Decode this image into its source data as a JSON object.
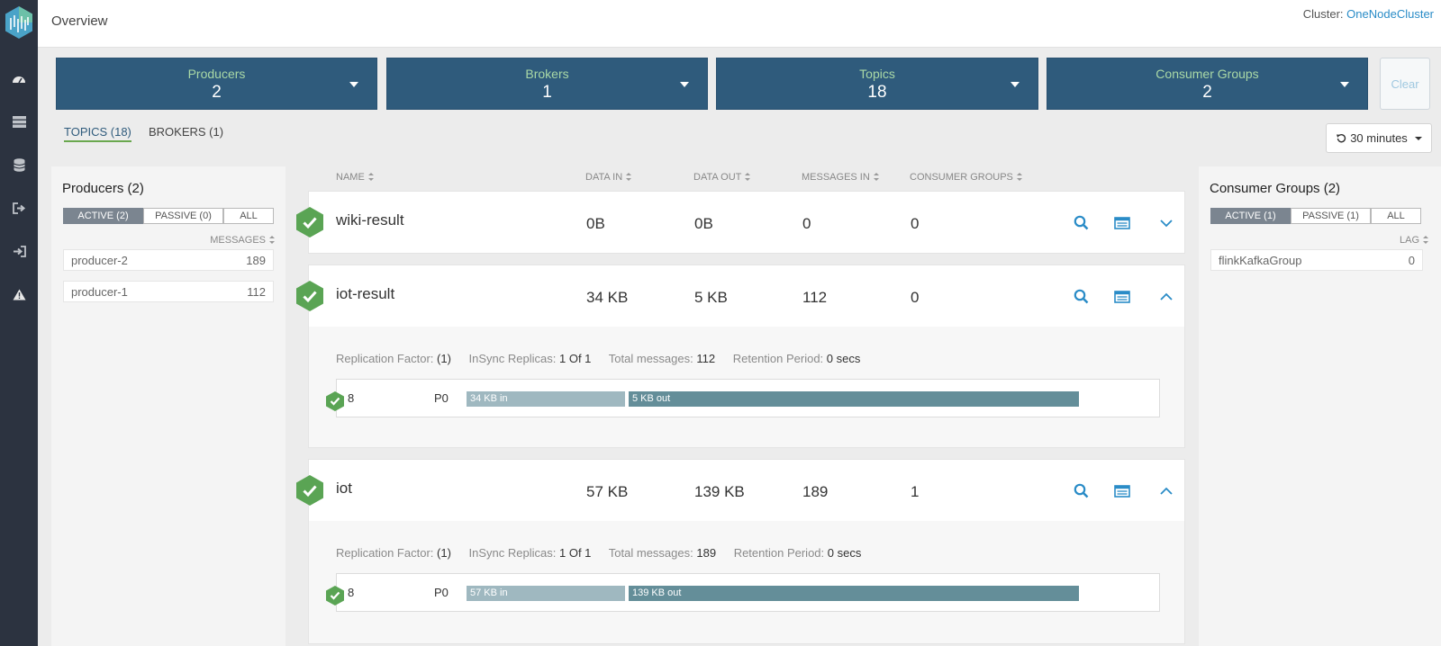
{
  "app": {
    "page_title": "Overview",
    "cluster_label": "Cluster:",
    "cluster_name": "OneNodeCluster"
  },
  "nav": [
    {
      "name": "dashboard-icon"
    },
    {
      "name": "brokers-list-icon"
    },
    {
      "name": "database-icon"
    },
    {
      "name": "sign-out-icon"
    },
    {
      "name": "sign-in-icon"
    },
    {
      "name": "alert-icon"
    }
  ],
  "stats": [
    {
      "label": "Producers",
      "value": "2"
    },
    {
      "label": "Brokers",
      "value": "1"
    },
    {
      "label": "Topics",
      "value": "18"
    },
    {
      "label": "Consumer Groups",
      "value": "2"
    }
  ],
  "clear_label": "Clear",
  "tabs": [
    {
      "label": "TOPICS (18)"
    },
    {
      "label": "BROKERS (1)"
    }
  ],
  "time_range": "30 minutes",
  "producers_panel": {
    "title": "Producers (2)",
    "filters": [
      "ACTIVE (2)",
      "PASSIVE (0)",
      "ALL"
    ],
    "column": "MESSAGES",
    "rows": [
      {
        "name": "producer-2",
        "value": "189"
      },
      {
        "name": "producer-1",
        "value": "112"
      }
    ]
  },
  "consumers_panel": {
    "title": "Consumer Groups (2)",
    "filters": [
      "ACTIVE (1)",
      "PASSIVE (1)",
      "ALL"
    ],
    "column": "LAG",
    "rows": [
      {
        "name": "flinkKafkaGroup",
        "value": "0"
      }
    ]
  },
  "columns": [
    "NAME",
    "DATA IN",
    "DATA OUT",
    "MESSAGES IN",
    "CONSUMER GROUPS"
  ],
  "topics": [
    {
      "name": "wiki-result",
      "data_in": "0B",
      "data_out": "0B",
      "messages_in": "0",
      "consumer_groups": "0",
      "expanded": false
    },
    {
      "name": "iot-result",
      "data_in": "34 KB",
      "data_out": "5 KB",
      "messages_in": "112",
      "consumer_groups": "0",
      "expanded": true,
      "details": {
        "replication_label": "Replication Factor:",
        "replication": "(1)",
        "insync_label": "InSync Replicas:",
        "insync": "1 Of 1",
        "total_label": "Total messages:",
        "total": "112",
        "retention_label": "Retention Period:",
        "retention": "0 secs",
        "partition": {
          "broker": "8",
          "name": "P0",
          "in": "34 KB in",
          "out": "5 KB out"
        }
      }
    },
    {
      "name": "iot",
      "data_in": "57 KB",
      "data_out": "139 KB",
      "messages_in": "189",
      "consumer_groups": "1",
      "expanded": true,
      "details": {
        "replication_label": "Replication Factor:",
        "replication": "(1)",
        "insync_label": "InSync Replicas:",
        "insync": "1 Of 1",
        "total_label": "Total messages:",
        "total": "189",
        "retention_label": "Retention Period:",
        "retention": "0 secs",
        "partition": {
          "broker": "8",
          "name": "P0",
          "in": "57 KB in",
          "out": "139 KB out"
        }
      }
    }
  ],
  "colors": {
    "nav_bg": "#2c3340",
    "stat_bg": "#2f5b7c",
    "stat_label": "#a9d8a6",
    "ok_green": "#5aa454",
    "link": "#2a8cc7",
    "bar_in": "#9fb8c0",
    "bar_out": "#648e99"
  }
}
